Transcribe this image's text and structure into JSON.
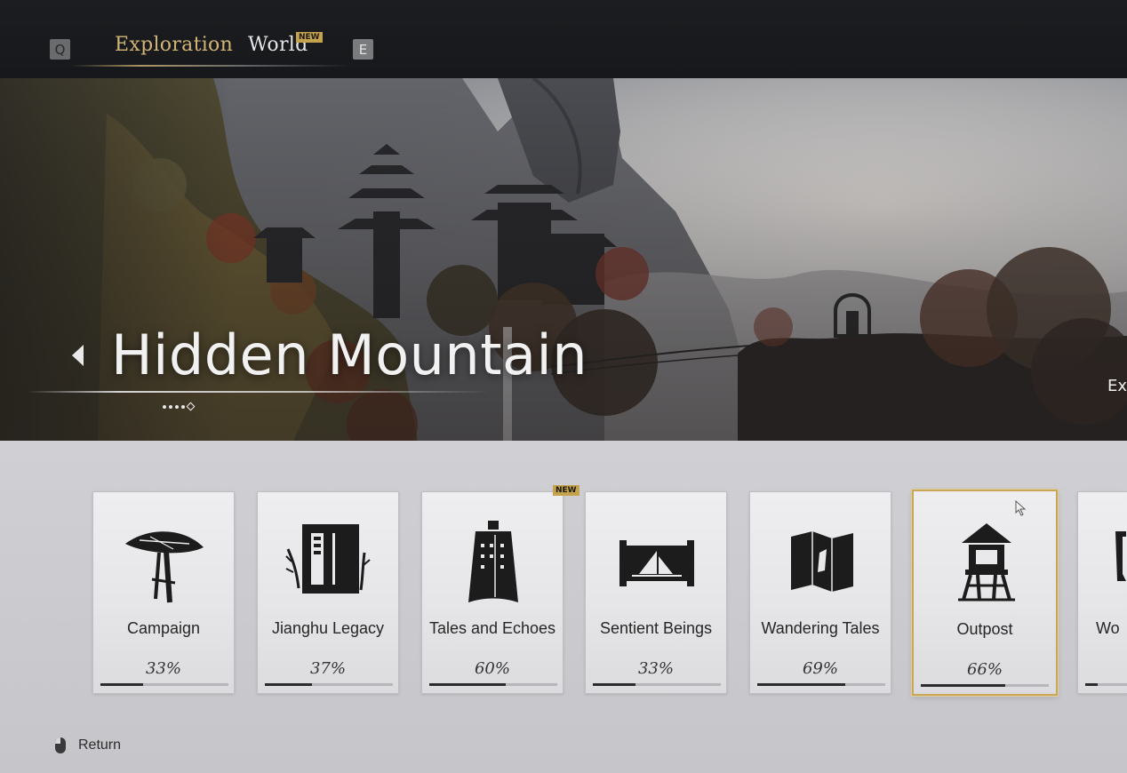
{
  "header": {
    "prev_key": "Q",
    "next_key": "E",
    "tabs": [
      {
        "label": "Exploration",
        "active": true
      },
      {
        "label": "World",
        "badge": "NEW"
      }
    ]
  },
  "banner": {
    "region_title": "Hidden Mountain",
    "next_region_partial": "Ex",
    "page_count": 5,
    "active_page": 5
  },
  "cards": [
    {
      "label": "Campaign",
      "percent": "33%",
      "progress": 0.33,
      "icon": "straw-hat-icon"
    },
    {
      "label": "Jianghu Legacy",
      "percent": "37%",
      "progress": 0.37,
      "icon": "shrine-book-icon"
    },
    {
      "label": "Tales and Echoes",
      "percent": "60%",
      "progress": 0.6,
      "icon": "bell-icon",
      "badge": "NEW"
    },
    {
      "label": "Sentient Beings",
      "percent": "33%",
      "progress": 0.33,
      "icon": "scroll-painting-icon"
    },
    {
      "label": "Wandering Tales",
      "percent": "69%",
      "progress": 0.69,
      "icon": "folded-map-icon"
    },
    {
      "label": "Outpost",
      "percent": "66%",
      "progress": 0.66,
      "icon": "watchtower-icon",
      "selected": true
    },
    {
      "label": "Wo",
      "percent": "",
      "progress": 0.3,
      "icon": "partial-icon"
    }
  ],
  "footer": {
    "return_label": "Return"
  },
  "colors": {
    "accent_gold": "#c8a65a",
    "tab_active": "#d2b574",
    "badge_bg": "#c4a24e",
    "topbar_bg": "#1b1d20"
  }
}
